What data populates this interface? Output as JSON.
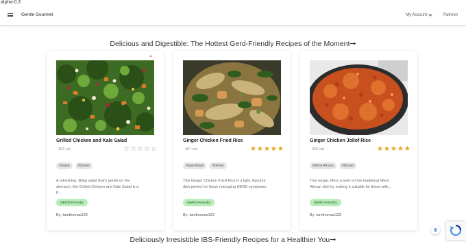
{
  "version": "alpha-0.3",
  "nav": {
    "brand": "Gentle Gourmet",
    "account": "My Account",
    "patreon": "Patreon"
  },
  "section1": {
    "title": "Delicious and Digestible: The Hottest Gerd-Friendly Recipes of the Moment",
    "arrow": "➞"
  },
  "section2": {
    "title": "Deliciously Irresistible IBS-Friendly Recipes for a Healthier You",
    "arrow": "➞"
  },
  "cards": [
    {
      "title": "Grilled Chicken and Kale Salad",
      "calories": "302 cal",
      "rating": 0,
      "tags": [
        "#Salad",
        "#Dinner"
      ],
      "description": "A refreshing, filling salad that's gentle on the stomach, this Grilled Chicken and Kale Salad is a p...",
      "badge": "GERD-Friendly",
      "author": "By: tamthomas123",
      "image_icon": "salad-photo"
    },
    {
      "title": "Ginger Chicken Fried Rice",
      "calories": "407 cal",
      "rating": 5,
      "tags": [
        "#East Asian",
        "#Dinner"
      ],
      "description": "This Ginger Chicken Fried Rice is a light, flavorful dish perfect for those managing GERD symptoms. ...",
      "badge": "GERD-Friendly",
      "author": "By: tamthomas123",
      "image_icon": "fried-rice-photo"
    },
    {
      "title": "Ginger Chicken Jollof Rice",
      "calories": "325 cal",
      "rating": 5,
      "tags": [
        "#West African",
        "#Dinner"
      ],
      "description": "This recipe offers a twist on the traditional West African dish by making it suitable for those with...",
      "badge": "GERD-Friendly",
      "author": "By: tamthomas123",
      "image_icon": "jollof-rice-photo"
    }
  ],
  "colors": {
    "star_on": "#e5a21a",
    "star_off": "#999999",
    "badge_bg": "#b9ecb9",
    "tag_bg": "#e6e6e6"
  }
}
